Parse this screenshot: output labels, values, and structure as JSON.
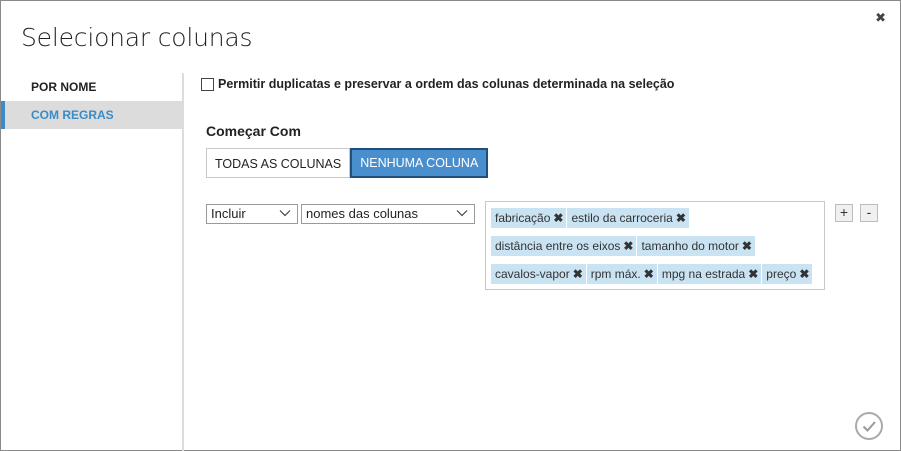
{
  "dialog": {
    "title": "Selecionar colunas",
    "close_glyph": "✖"
  },
  "sidebar": {
    "items": [
      {
        "label": "POR NOME",
        "active": false
      },
      {
        "label": "COM REGRAS",
        "active": true
      }
    ]
  },
  "main": {
    "duplicates_checkbox": {
      "checked": false,
      "label": "Permitir duplicatas e preservar a ordem das colunas determinada na seleção"
    },
    "start_with_label": "Começar Com",
    "start_options": [
      {
        "label": "TODAS AS COLUNAS",
        "selected": false
      },
      {
        "label": "NENHUMA COLUNA",
        "selected": true
      }
    ],
    "rule": {
      "mode": "Incluir",
      "criteria": "nomes das colunas",
      "tags": [
        "fabricação",
        "estilo da carroceria",
        "distância entre os eixos",
        "tamanho do motor",
        "cavalos-vapor",
        "rpm máx.",
        "mpg na estrada",
        "preço"
      ]
    },
    "add_rule_label": "+",
    "remove_rule_label": "-"
  },
  "colors": {
    "accent": "#3a8cc8",
    "selected_button": "#4a8fcd",
    "tag_background": "#c9e3f3"
  }
}
